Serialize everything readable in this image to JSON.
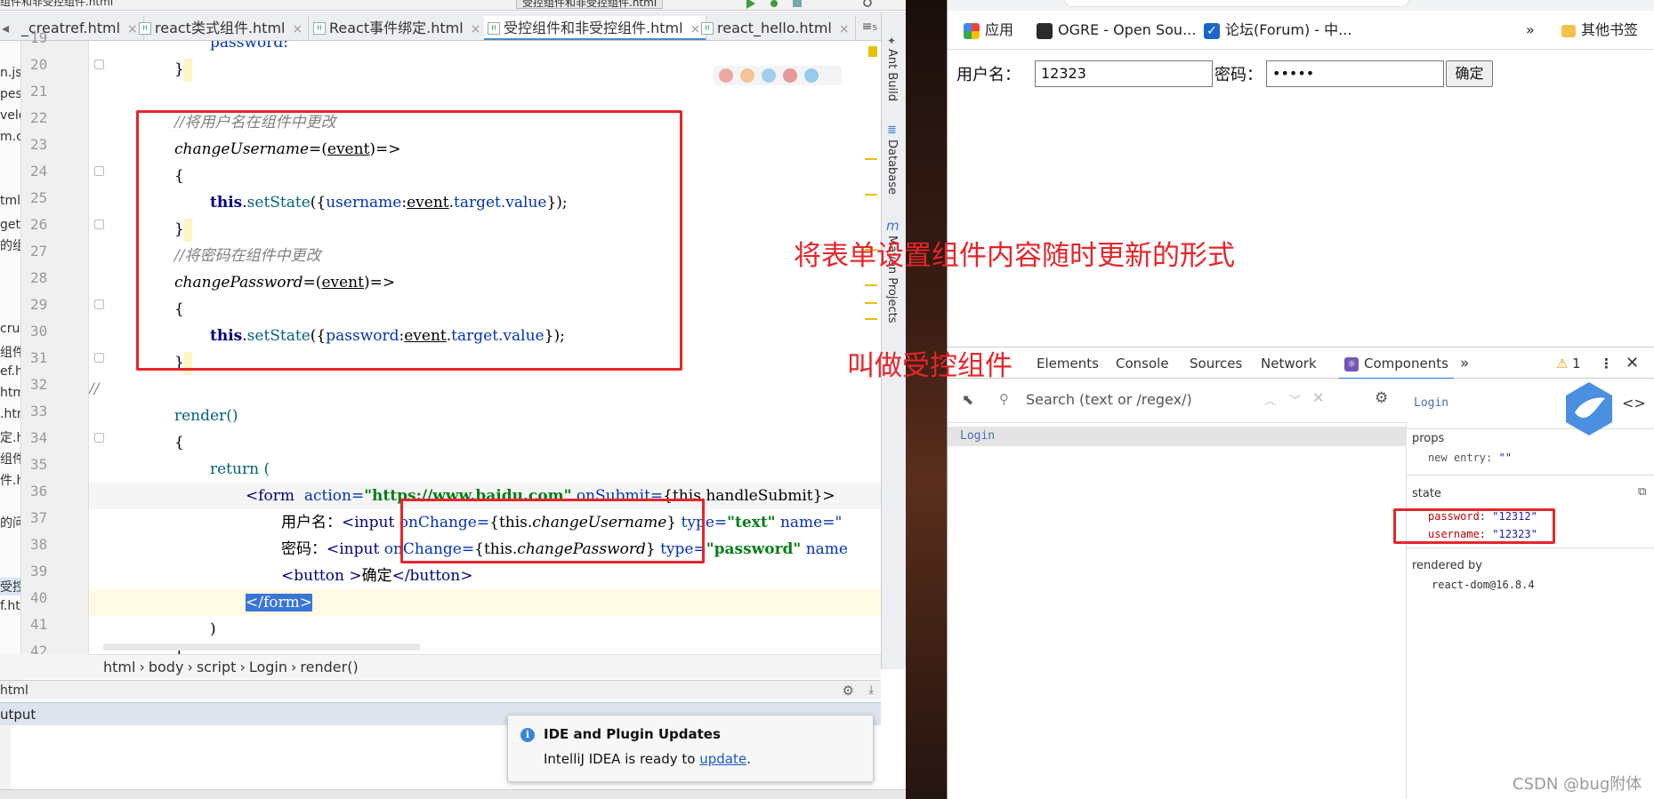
{
  "ide": {
    "window_title": "组件和非受控组件.html",
    "window_title_right": "受控组件和非受控组件.html",
    "tabs": [
      {
        "label": "_creatref.html",
        "active": false
      },
      {
        "label": "react类式组件.html",
        "active": false
      },
      {
        "label": "React事件绑定.html",
        "active": false
      },
      {
        "label": "受控组件和非受控组件.html",
        "active": true
      },
      {
        "label": "react_hello.html",
        "active": false
      }
    ],
    "tab_overflow": "≡₅",
    "project_tree_fragments": [
      "n.js",
      "pes.",
      "velo",
      "m.c",
      "tml",
      "get标",
      "的组",
      "crus",
      "组件",
      "ef.h",
      "htm",
      ".htm",
      "定.h",
      "组件",
      "件.h",
      "的问",
      "受控",
      "f.htm"
    ],
    "line_numbers": [
      "19",
      "20",
      "21",
      "22",
      "23",
      "24",
      "25",
      "26",
      "27",
      "28",
      "29",
      "30",
      "31",
      "32",
      "33",
      "34",
      "35",
      "36",
      "37",
      "38",
      "39",
      "40",
      "41",
      "42"
    ],
    "breadcrumb": [
      "html",
      "body",
      "script",
      "Login",
      "render()"
    ],
    "side_tools": [
      "Ant Build",
      "Database",
      "Maven Projects"
    ],
    "run_tab": "html",
    "output_tab": "utput",
    "notification": {
      "title": "IDE and Plugin Updates",
      "body_prefix": "IntelliJ IDEA is ready to ",
      "link": "update",
      "body_suffix": "."
    }
  },
  "code": {
    "l19": "password:",
    "l20": "}",
    "l22": "//将用户名在组件中更改",
    "l23_name": "changeUsername",
    "l23_param": "event",
    "l24": "{",
    "l25_this": "this",
    "l25_fn": "setState",
    "l25_key": "username",
    "l25_ev": "event",
    "l25_rest": "target.value",
    "l26": "}",
    "l27": "//将密码在组件中更改",
    "l28_name": "changePassword",
    "l28_param": "event",
    "l29": "{",
    "l30_this": "this",
    "l30_fn": "setState",
    "l30_key": "password",
    "l30_ev": "event",
    "l30_rest": "target.value",
    "l31": "}",
    "l32": "//",
    "l33": "render()",
    "l34": "{",
    "l35": "return (",
    "l36_tag": "<form",
    "l36_attr": "action=",
    "l36_url": "\"https://www.baidu.com\"",
    "l36_attr2": "onSubmit=",
    "l36_val": "{this.handleSubmit}",
    "l37_label": "用户名：",
    "l37_tag": "<input",
    "l37_attr": "onChange=",
    "l37_this": "{this.",
    "l37_fn": "changeUsername",
    "l37_close": "}",
    "l37_type": "type=",
    "l37_typeval": "\"text\"",
    "l37_name": "name=\"",
    "l38_label": "密码：",
    "l38_tag": "<input",
    "l38_attr": "onChange=",
    "l38_this": "{this.",
    "l38_fn": "changePassword",
    "l38_close": "}",
    "l38_type": "type=",
    "l38_typeval": "\"password\"",
    "l38_name": "name",
    "l39_open": "<button >",
    "l39_text": "确定",
    "l39_close": "</button>",
    "l40": "</form>",
    "l41": ")",
    "l42": "}"
  },
  "browser": {
    "bookmarks": [
      {
        "label": "应用",
        "icon": "apps-grid-icon"
      },
      {
        "label": "OGRE - Open Sou...",
        "icon": "ogre-icon"
      },
      {
        "label": "论坛(Forum) - 中...",
        "icon": "checkbox-icon"
      }
    ],
    "bookmarks_more": "»",
    "other_bookmarks": "其他书签",
    "form": {
      "username_label": "用户名：",
      "username_value": "12323",
      "password_label": "密码：",
      "password_value": "•••••",
      "submit_label": "确定"
    },
    "devtools": {
      "tabs": [
        "Elements",
        "Console",
        "Sources",
        "Network",
        "Components"
      ],
      "active_tab": "Components",
      "more": "»",
      "warning_count": "1",
      "search_placeholder": "Search (text or /regex/)",
      "tree_item": "Login",
      "selected_component": "Login",
      "props_header": "props",
      "props_new_entry_key": "new entry",
      "props_new_entry_value": "\"\"",
      "state_header": "state",
      "state_password_key": "password",
      "state_password_value": "\"12312\"",
      "state_username_key": "username",
      "state_username_value": "\"12323\"",
      "rendered_by_header": "rendered by",
      "rendered_by_value": "react-dom@16.8.4"
    }
  },
  "annotations": {
    "line1": "将表单设置组件内容随时更新的形式",
    "line2": "叫做受控组件"
  },
  "watermark": "CSDN @bug附体",
  "colors": {
    "annotation_red": "#e6252a",
    "code_keyword": "#000080",
    "code_string": "#067d17",
    "code_function": "#00627a",
    "code_comment": "#808080",
    "devtools_accent": "#1a73e8"
  }
}
